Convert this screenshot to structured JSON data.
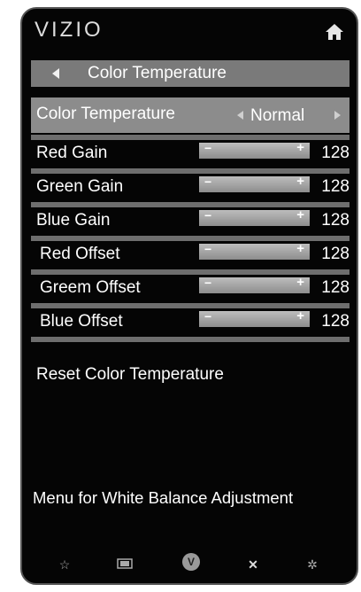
{
  "brand": {
    "logo": "VIZIO"
  },
  "header": {
    "breadcrumb": "Color Temperature"
  },
  "settings": {
    "selected": {
      "label": "Color Temperature",
      "value": "Normal"
    },
    "rows": [
      {
        "label": "Red Gain",
        "value": "128"
      },
      {
        "label": "Green Gain",
        "value": "128"
      },
      {
        "label": "Blue Gain",
        "value": "128"
      },
      {
        "label": "Red Offset",
        "value": "128"
      },
      {
        "label": "Greem Offset",
        "value": "128"
      },
      {
        "label": "Blue Offset",
        "value": "128"
      }
    ],
    "reset_label": "Reset Color Temperature"
  },
  "footer": {
    "description": "Menu for White Balance Adjustment"
  },
  "slider": {
    "minus": "−",
    "plus": "+"
  },
  "bottom_bar": {
    "icons": [
      "star-icon",
      "widescreen-icon",
      "vizio-v-icon",
      "close-icon",
      "gear-icon"
    ],
    "v_glyph": "V"
  },
  "colors": {
    "background": "#050505",
    "highlight": "#8c8c8c",
    "separator": "#6e6e6e",
    "text": "#ffffff"
  }
}
